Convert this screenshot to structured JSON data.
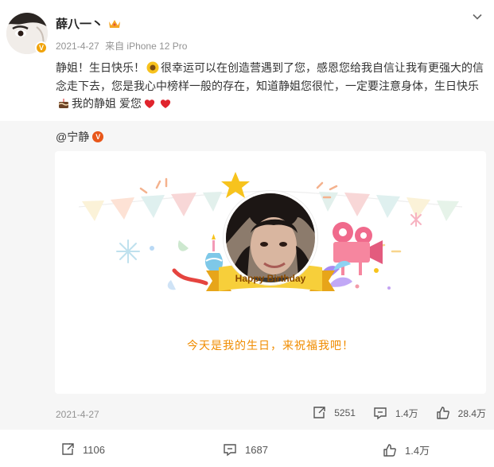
{
  "author": {
    "name": "薛八一丶",
    "date": "2021-4-27",
    "source": "来自 iPhone 12 Pro"
  },
  "post": {
    "text_part1": "静姐！生日快乐！",
    "text_part2": "很幸运可以在创造营遇到了您，感恩您给我自信让我有更强大的信念走下去，您是我心中榜样一般的存在，知道静姐您很忙，一定要注意身体，生日快乐",
    "text_part3": "我的静姐 爱您"
  },
  "retweet": {
    "author": "@宁静",
    "card_banner": "Happy Birthday",
    "card_caption": "今天是我的生日，来祝福我吧！",
    "date": "2021-4-27",
    "reposts": "5251",
    "comments": "1.4万",
    "likes": "28.4万"
  },
  "actions": {
    "reposts": "1106",
    "comments": "1687",
    "likes": "1.4万"
  },
  "colors": {
    "accent": "#f08c00",
    "heart": "#e0242c"
  }
}
